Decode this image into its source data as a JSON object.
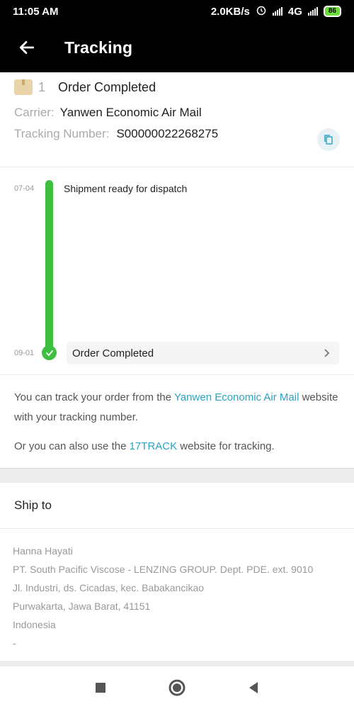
{
  "status_bar": {
    "time": "11:05 AM",
    "net_speed": "2.0KB/s",
    "network": "4G",
    "battery": "86",
    "icons": [
      "alarm-icon",
      "signal-icon",
      "battery-icon"
    ]
  },
  "app_bar": {
    "title": "Tracking",
    "back_icon": "arrow-left-icon"
  },
  "order": {
    "count": "1",
    "status": "Order Completed",
    "carrier_label": "Carrier:",
    "carrier": "Yanwen Economic Air Mail",
    "tracking_label": "Tracking Number:",
    "tracking_number": "S00000022268275"
  },
  "timeline": [
    {
      "date": "07-04",
      "text": "Shipment ready for dispatch"
    },
    {
      "date": "09-01",
      "text": "Order Completed"
    }
  ],
  "help": {
    "line1_pre": "You can track your order from the ",
    "line1_link": "Yanwen Economic Air Mail",
    "line1_post": " website with your tracking number.",
    "line2_pre": "Or you can also use the ",
    "line2_link": "17TRACK",
    "line2_post": " website for tracking."
  },
  "ship_to": {
    "title": "Ship to",
    "lines": [
      "Hanna Hayati",
      "PT. South Pacific Viscose -  LENZING GROUP. Dept. PDE.  ext.  9010",
      "Jl. Industri,  ds. Cicadas,  kec.  Babakancikao",
      "Purwakarta, Jawa Barat, 41151",
      "Indonesia",
      "-"
    ]
  },
  "colors": {
    "accent_green": "#3fbf3f",
    "link_blue": "#2aa4c3",
    "header_bg": "#000000"
  }
}
